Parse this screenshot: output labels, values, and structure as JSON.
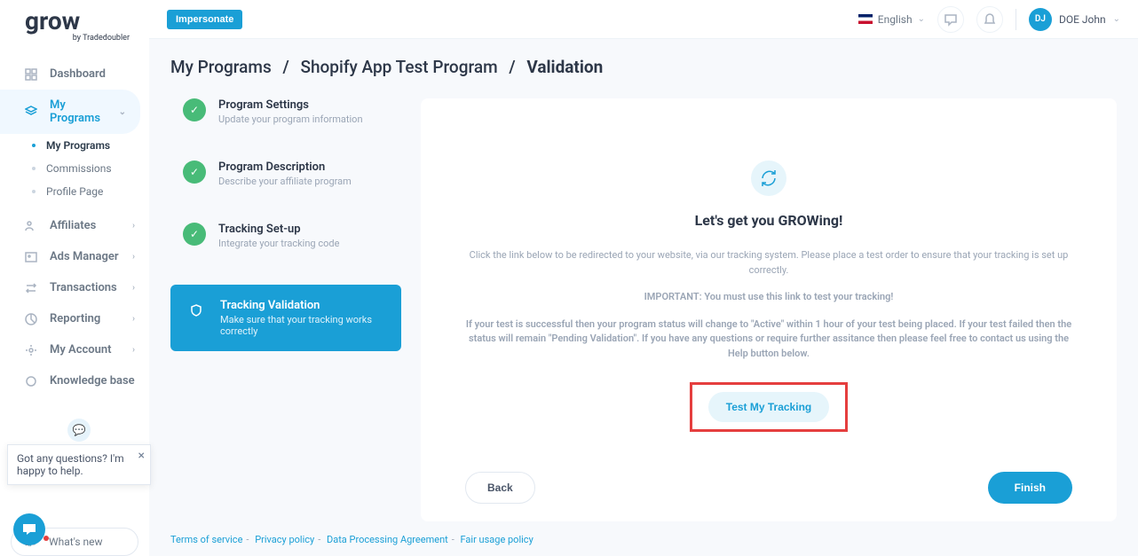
{
  "topbar": {
    "impersonate": "Impersonate",
    "language": "English",
    "user_initials": "DJ",
    "user_name": "DOE John"
  },
  "sidebar": {
    "logo_main": "grow",
    "logo_sub": "by Tradedoubler",
    "items": [
      {
        "label": "Dashboard"
      },
      {
        "label": "My Programs"
      },
      {
        "label": "Affiliates"
      },
      {
        "label": "Ads Manager"
      },
      {
        "label": "Transactions"
      },
      {
        "label": "Reporting"
      },
      {
        "label": "My Account"
      },
      {
        "label": "Knowledge base"
      }
    ],
    "sub": [
      {
        "label": "My Programs"
      },
      {
        "label": "Commissions"
      },
      {
        "label": "Profile Page"
      }
    ],
    "whatsnew": "What's new"
  },
  "breadcrumb": {
    "a": "My Programs",
    "b": "Shopify App Test Program",
    "c": "Validation"
  },
  "steps": [
    {
      "title": "Program Settings",
      "desc": "Update your program information"
    },
    {
      "title": "Program Description",
      "desc": "Describe your affiliate program"
    },
    {
      "title": "Tracking Set-up",
      "desc": "Integrate your tracking code"
    },
    {
      "title": "Tracking Validation",
      "desc": "Make sure that your tracking works correctly"
    }
  ],
  "panel": {
    "heading": "Let's get you GROWing!",
    "p1": "Click the link below to be redirected to your website, via our tracking system. Please place a test order to ensure that your tracking is set up correctly.",
    "p2": "IMPORTANT: You must use this link to test your tracking!",
    "p3": "If your test is successful then your program status will change to \"Active\" within 1 hour of your test being placed. If your test failed then the status will remain \"Pending Validation\". If you have any questions or require further assitance then please feel free to contact us using the Help button below.",
    "test_button": "Test My Tracking",
    "back": "Back",
    "finish": "Finish"
  },
  "chat": {
    "text": "Got any questions? I'm happy to help."
  },
  "footer": {
    "a": "Terms of service",
    "b": "Privacy policy",
    "c": "Data Processing Agreement",
    "d": "Fair usage policy"
  }
}
